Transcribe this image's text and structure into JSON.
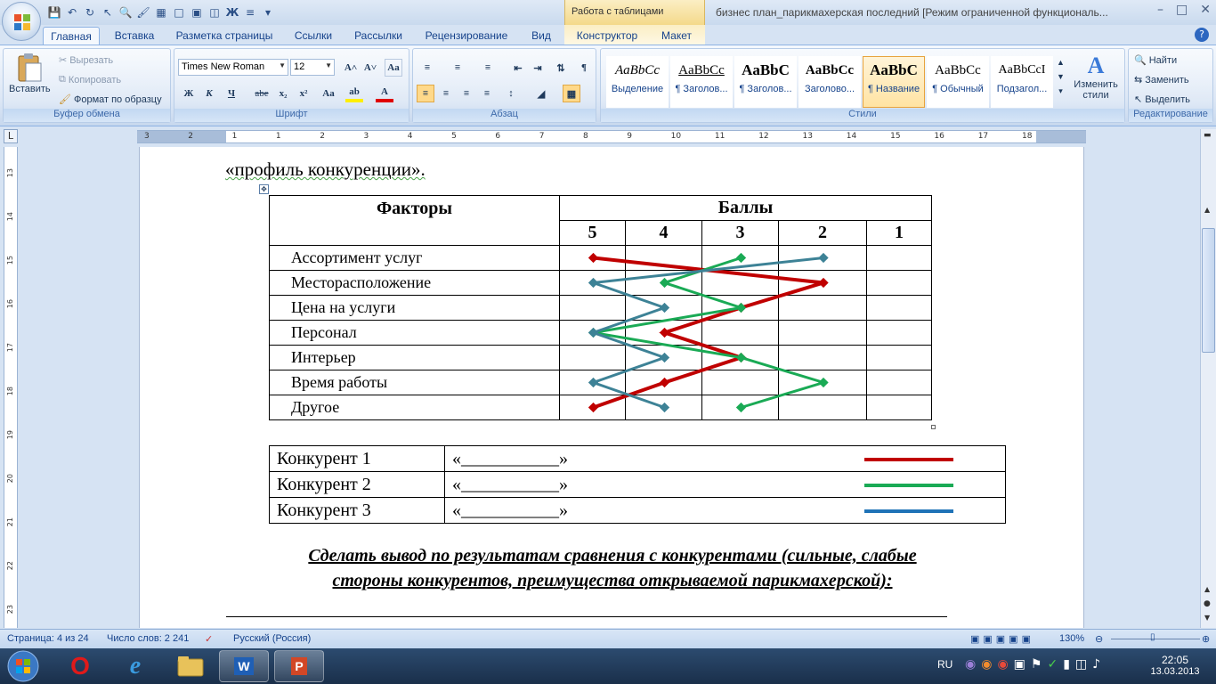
{
  "window": {
    "title": "бизнес план_парикмахерская последний [Режим ограниченной функциональ...",
    "context_tab_title": "Работа с таблицами"
  },
  "tabs": [
    "Главная",
    "Вставка",
    "Разметка страницы",
    "Ссылки",
    "Рассылки",
    "Рецензирование",
    "Вид",
    "Конструктор",
    "Макет"
  ],
  "clipboard": {
    "paste": "Вставить",
    "cut": "Вырезать",
    "copy": "Копировать",
    "format_painter": "Формат по образцу",
    "label": "Буфер обмена"
  },
  "font": {
    "name": "Times New Roman",
    "size": "12",
    "label": "Шрифт",
    "bold": "Ж",
    "italic": "К",
    "underline": "Ч",
    "strike": "abe",
    "sub": "x₂",
    "sup": "x²",
    "case": "Aa"
  },
  "paragraph": {
    "label": "Абзац"
  },
  "styles": {
    "label": "Стили",
    "items": [
      {
        "preview": "AaBbCc",
        "name": "Выделение"
      },
      {
        "preview": "AaBbCc",
        "name": "¶ Заголов..."
      },
      {
        "preview": "AaBbC",
        "name": "¶ Заголов..."
      },
      {
        "preview": "AaBbCc",
        "name": "Заголово..."
      },
      {
        "preview": "AaBbC",
        "name": "¶ Название"
      },
      {
        "preview": "AaBbCc",
        "name": "¶ Обычный"
      },
      {
        "preview": "AaBbCcI",
        "name": "Подзагол..."
      }
    ],
    "change": "Изменить стили"
  },
  "editing": {
    "find": "Найти",
    "replace": "Заменить",
    "select": "Выделить",
    "label": "Редактирование"
  },
  "ruler_numbers": [
    "3",
    "2",
    "1",
    "1",
    "2",
    "3",
    "4",
    "5",
    "6",
    "7",
    "8",
    "9",
    "10",
    "11",
    "12",
    "13",
    "14",
    "15",
    "16",
    "17",
    "18"
  ],
  "vruler_numbers": [
    "13",
    "14",
    "15",
    "16",
    "17",
    "18",
    "19",
    "20",
    "21",
    "22",
    "23"
  ],
  "document": {
    "heading": "«профиль конкуренции».",
    "factors_header": "Факторы",
    "scores_header": "Баллы",
    "scores": [
      "5",
      "4",
      "3",
      "2",
      "1"
    ],
    "factors": [
      "Ассортимент услуг",
      "Месторасположение",
      "Цена на услуги",
      "Персонал",
      "Интерьер",
      "Время работы",
      "Другое"
    ],
    "legend": [
      {
        "name": "Конкурент 1",
        "blank": "«___________»",
        "color": "#c00000"
      },
      {
        "name": "Конкурент 2",
        "blank": "«___________»",
        "color": "#1aaa55"
      },
      {
        "name": "Конкурент 3",
        "blank": "«___________»",
        "color": "#1f73b7"
      }
    ],
    "conclusion_line1": "Сделать вывод по результатам сравнения с конкурентами (сильные, слабые",
    "conclusion_line2": "стороны конкурентов, преимущества открываемой парикмахерской):"
  },
  "chart_data": {
    "type": "line",
    "categories": [
      "Ассортимент услуг",
      "Месторасположение",
      "Цена на услуги",
      "Персонал",
      "Интерьер",
      "Время работы",
      "Другое"
    ],
    "x_scale": [
      5,
      4,
      3,
      2,
      1
    ],
    "series": [
      {
        "name": "Конкурент 1",
        "color": "#c00000",
        "values": [
          5,
          2,
          3,
          4,
          3,
          4,
          5
        ]
      },
      {
        "name": "Конкурент 2",
        "color": "#1aaa55",
        "values": [
          3,
          4,
          3,
          5,
          3,
          2,
          3
        ]
      },
      {
        "name": "Конкурент 3",
        "color": "#3d8296",
        "values": [
          2,
          5,
          4,
          5,
          4,
          5,
          4
        ]
      }
    ]
  },
  "status": {
    "page": "Страница: 4 из 24",
    "words": "Число слов: 2 241",
    "language": "Русский (Россия)",
    "zoom": "130%"
  },
  "taskbar": {
    "lang": "RU",
    "time": "22:05",
    "date": "13.03.2013"
  }
}
